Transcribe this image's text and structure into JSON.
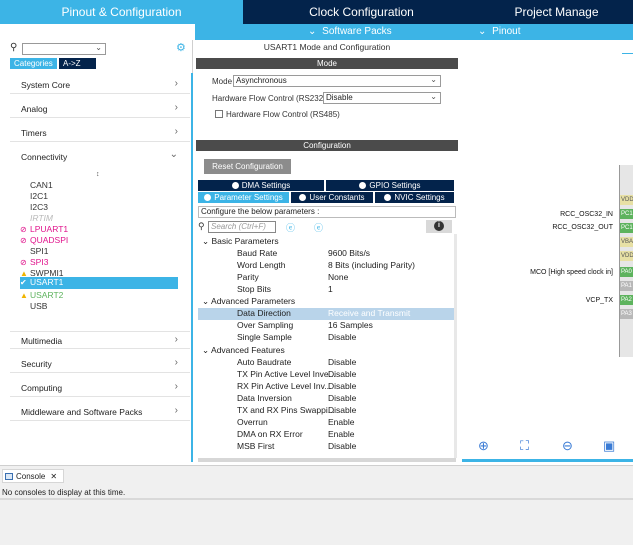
{
  "tabs": {
    "pinout": "Pinout & Configuration",
    "clock": "Clock Configuration",
    "project": "Project Manage"
  },
  "subbar": {
    "software_packs": "Software Packs",
    "pinout": "Pinout"
  },
  "left": {
    "search_value": "",
    "categories_btn": "Categories",
    "atoz_btn": "A->Z",
    "cats_top": [
      "System Core",
      "Analog",
      "Timers",
      "Connectivity"
    ],
    "peripherals": [
      {
        "name": "CAN1",
        "status": "none",
        "color": "#333333"
      },
      {
        "name": "I2C1",
        "status": "none",
        "color": "#333333"
      },
      {
        "name": "I2C3",
        "status": "none",
        "color": "#333333"
      },
      {
        "name": "IRTIM",
        "status": "disabled",
        "color": "#b9b9b9"
      },
      {
        "name": "LPUART1",
        "status": "conflict",
        "color": "#e0148c"
      },
      {
        "name": "QUADSPI",
        "status": "conflict",
        "color": "#e0148c"
      },
      {
        "name": "SPI1",
        "status": "none",
        "color": "#333333"
      },
      {
        "name": "SPI3",
        "status": "conflict",
        "color": "#e0148c"
      },
      {
        "name": "SWPMI1",
        "status": "warning",
        "color": "#333333"
      },
      {
        "name": "USART1",
        "status": "ok",
        "color": "#ffffff"
      },
      {
        "name": "USART2",
        "status": "warning",
        "color": "#5db35d"
      },
      {
        "name": "USB",
        "status": "none",
        "color": "#333333"
      }
    ],
    "cats_bottom": [
      "Multimedia",
      "Security",
      "Computing",
      "Middleware and Software Packs"
    ]
  },
  "mode_panel": {
    "title": "USART1 Mode and Configuration",
    "mode_header": "Mode",
    "mode_label": "Mode",
    "mode_value": "Asynchronous",
    "hfc_label": "Hardware Flow Control (RS232)",
    "hfc_value": "Disable",
    "rs485_label": "Hardware Flow Control (RS485)",
    "config_header": "Configuration",
    "reset_btn": "Reset Configuration",
    "tabs": [
      "DMA Settings",
      "GPIO Settings",
      "Parameter Settings",
      "User Constants",
      "NVIC Settings"
    ],
    "configure_label": "Configure the below parameters :",
    "search_placeholder": "Search (Ctrl+F)",
    "groups": {
      "basic": "Basic Parameters",
      "advanced": "Advanced Parameters",
      "features": "Advanced Features"
    },
    "basic_params": [
      {
        "name": "Baud Rate",
        "value": "9600 Bits/s"
      },
      {
        "name": "Word Length",
        "value": "8 Bits (including Parity)"
      },
      {
        "name": "Parity",
        "value": "None"
      },
      {
        "name": "Stop Bits",
        "value": "1"
      }
    ],
    "advanced_params": [
      {
        "name": "Data Direction",
        "value": "Receive and Transmit"
      },
      {
        "name": "Over Sampling",
        "value": "16 Samples"
      },
      {
        "name": "Single Sample",
        "value": "Disable"
      }
    ],
    "features_params": [
      {
        "name": "Auto Baudrate",
        "value": "Disable"
      },
      {
        "name": "TX Pin Active Level Inve...",
        "value": "Disable"
      },
      {
        "name": "RX Pin Active Level Inv...",
        "value": "Disable"
      },
      {
        "name": "Data Inversion",
        "value": "Disable"
      },
      {
        "name": "TX and RX Pins Swappi...",
        "value": "Disable"
      },
      {
        "name": "Overrun",
        "value": "Enable"
      },
      {
        "name": "DMA on RX Error",
        "value": "Enable"
      },
      {
        "name": "MSB First",
        "value": "Disable"
      }
    ]
  },
  "chip": {
    "labels": [
      "RCC_OSC32_IN",
      "RCC_OSC32_OUT",
      "MCO [High speed clock in]",
      "VCP_TX"
    ],
    "pins": [
      {
        "text": "VDD",
        "color": "#e7e0a5"
      },
      {
        "text": "PC1",
        "color": "#5db35d"
      },
      {
        "text": "PC1",
        "color": "#5db35d"
      },
      {
        "text": "VBA",
        "color": "#e7e0a5"
      },
      {
        "text": "VDD",
        "color": "#e7e0a5"
      },
      {
        "text": "PA0",
        "color": "#5db35d"
      },
      {
        "text": "PA1",
        "color": "#b8b8b8"
      },
      {
        "text": "PA2",
        "color": "#5db35d"
      },
      {
        "text": "PA3",
        "color": "#b8b8b8"
      }
    ]
  },
  "console": {
    "tab_label": "Console",
    "message": "No consoles to display at this time."
  }
}
